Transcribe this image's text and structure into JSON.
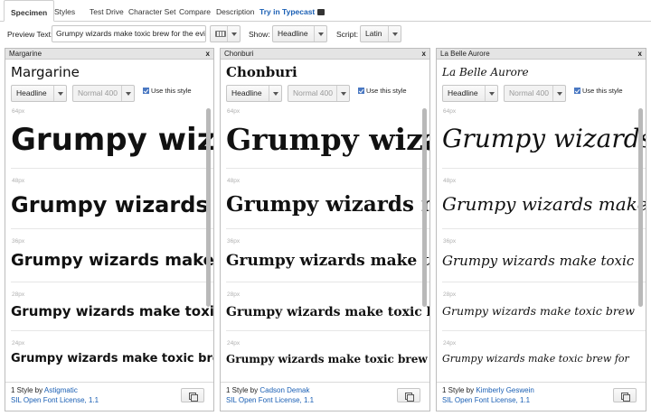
{
  "tabs": [
    {
      "label": "Specimen",
      "active": true
    },
    {
      "label": "Styles"
    },
    {
      "label": "Test Drive"
    },
    {
      "label": "Character Set"
    },
    {
      "label": "Compare"
    },
    {
      "label": "Description"
    },
    {
      "label": "Try in Typecast"
    }
  ],
  "toolbar": {
    "preview_label": "Preview Text:",
    "preview_value": "Grumpy wizards make toxic brew for the evil",
    "show_label": "Show:",
    "show_value": "Headline",
    "script_label": "Script:",
    "script_value": "Latin",
    "keyboard_icon": "keyboard-icon"
  },
  "panels": [
    {
      "header": "Margarine",
      "close": "x",
      "title": "Margarine",
      "style_select": "Headline",
      "weight_select": "Normal 400",
      "use_style": "Use this style",
      "samples": [
        {
          "size": "64px",
          "text": "Grumpy wizards"
        },
        {
          "size": "48px",
          "text": "Grumpy wizards make"
        },
        {
          "size": "36px",
          "text": "Grumpy wizards make toxic"
        },
        {
          "size": "28px",
          "text": "Grumpy wizards make toxic brew"
        },
        {
          "size": "24px",
          "text": "Grumpy wizards make toxic brew for"
        }
      ],
      "footer_prefix": "1 Style by ",
      "designer": "Astigmatic",
      "license": "SIL Open Font License, 1.1"
    },
    {
      "header": "Chonburi",
      "close": "x",
      "title": "Chonburi",
      "style_select": "Headline",
      "weight_select": "Normal 400",
      "use_style": "Use this style",
      "samples": [
        {
          "size": "64px",
          "text": "Grumpy wizards"
        },
        {
          "size": "48px",
          "text": "Grumpy wizards make"
        },
        {
          "size": "36px",
          "text": "Grumpy wizards make toxic"
        },
        {
          "size": "28px",
          "text": "Grumpy wizards make toxic brew"
        },
        {
          "size": "24px",
          "text": "Grumpy wizards make toxic brew for"
        }
      ],
      "footer_prefix": "1 Style by ",
      "designer": "Cadson Demak",
      "license": "SIL Open Font License, 1.1"
    },
    {
      "header": "La Belle Aurore",
      "close": "x",
      "title": "La Belle Aurore",
      "style_select": "Headline",
      "weight_select": "Normal 400",
      "use_style": "Use this style",
      "samples": [
        {
          "size": "64px",
          "text": "Grumpy wizards"
        },
        {
          "size": "48px",
          "text": "Grumpy wizards make"
        },
        {
          "size": "36px",
          "text": "Grumpy wizards make toxic"
        },
        {
          "size": "28px",
          "text": "Grumpy wizards make toxic brew"
        },
        {
          "size": "24px",
          "text": "Grumpy wizards make toxic brew for"
        }
      ],
      "footer_prefix": "1 Style by ",
      "designer": "Kimberly Geswein",
      "license": "SIL Open Font License, 1.1"
    }
  ],
  "colors": {
    "link": "#1a5fb4",
    "checkbox": "#4a78c2"
  }
}
